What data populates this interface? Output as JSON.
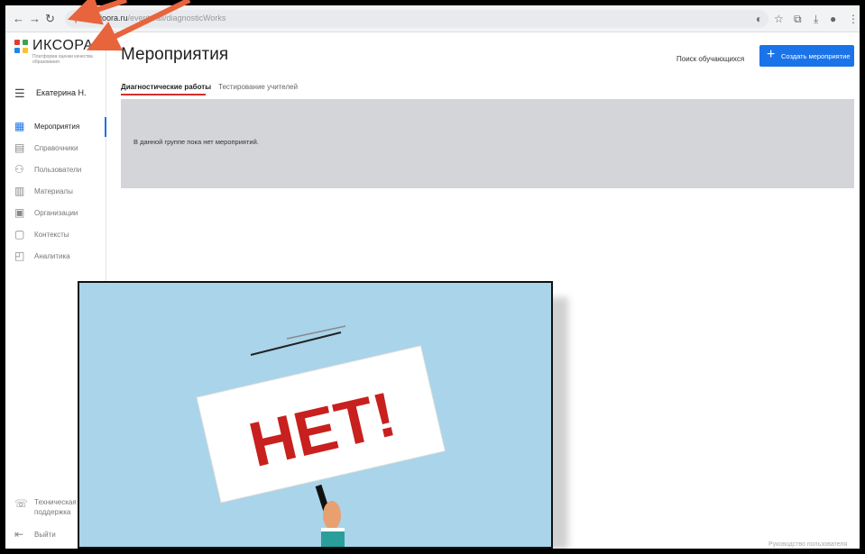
{
  "browser": {
    "url_host": "oko.ioora.ru",
    "url_path": "/events/all/diagnosticWorks"
  },
  "sidebar": {
    "logo_title": "ИКСОРА",
    "logo_subtitle": "Платформа оценки качества образования",
    "user_name": "Екатерина Н.",
    "items": [
      {
        "label": "Мероприятия",
        "icon": "calendar-icon"
      },
      {
        "label": "Справочники",
        "icon": "book-icon"
      },
      {
        "label": "Пользователи",
        "icon": "users-icon"
      },
      {
        "label": "Материалы",
        "icon": "materials-icon"
      },
      {
        "label": "Организации",
        "icon": "building-icon"
      },
      {
        "label": "Контексты",
        "icon": "context-icon"
      },
      {
        "label": "Аналитика",
        "icon": "analytics-icon"
      }
    ],
    "support_label": "Техническая поддержка",
    "logout_label": "Выйти"
  },
  "main": {
    "title": "Мероприятия",
    "search_label": "Поиск обучающихся",
    "create_label": "Создать мероприятие",
    "tabs": [
      {
        "label": "Диагностические работы",
        "active": true
      },
      {
        "label": "Тестирование учителей",
        "active": false
      }
    ],
    "empty_message": "В данной группе пока нет мероприятий.",
    "guide_link": "Руководство пользователя"
  },
  "overlay": {
    "sign_text": "НЕТ!"
  },
  "colors": {
    "accent": "#1a73e8",
    "tab_underline": "#d32f2f",
    "arrow": "#e8643c",
    "sign_text": "#c8201e",
    "overlay_bg": "#a9d4ea"
  }
}
